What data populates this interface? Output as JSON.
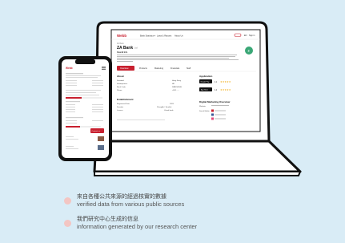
{
  "colors": {
    "background": "#d9ecf6",
    "brand_red": "#c8202f",
    "accent_green": "#3aa776",
    "legend_dot": "#f3c6c3",
    "outline": "#111111"
  },
  "laptop_screen": {
    "brand": "Webb",
    "nav": [
      "Bank Statistics ▾",
      "Laws & Reports",
      "About Us"
    ],
    "lang": "EN",
    "signin": "Sign in",
    "breadcrumb": "ZA Bank",
    "title": "ZA Bank",
    "title_badge": "Ltd",
    "subtitle": "Overall Info",
    "tabs": [
      "Overview",
      "Products",
      "Marketing",
      "Financials",
      "Staff"
    ],
    "about": {
      "heading": "About",
      "rows": [
        {
          "k": "Founded",
          "v": "Hong Kong"
        },
        {
          "k": "Headquarters",
          "v": "HK"
        },
        {
          "k": "Bank Code",
          "v": "ZABKHKHH"
        },
        {
          "k": "Phone",
          "v": "+852 ....."
        }
      ]
    },
    "establishment": {
      "heading": "Establishment",
      "rows": [
        {
          "k": "Registered Date",
          "v": "2019"
        },
        {
          "k": "Founder",
          "v": "ZhongAn / Sinolink"
        },
        {
          "k": "Licence",
          "v": "Virtual bank"
        }
      ]
    },
    "application": {
      "heading": "Application",
      "stores": [
        "Google Play",
        "App Store"
      ],
      "ratings": [
        "4.1",
        "4.4"
      ]
    },
    "digital": {
      "heading": "Digital Marketing Overview",
      "rows": [
        "Website",
        "Social Media"
      ]
    }
  },
  "phone_screen": {
    "brand": "Webb",
    "cta": "Contact us"
  },
  "legend": [
    {
      "zh": "來自各種公共來源的經過核實的數據",
      "en": "verified data from various public sources"
    },
    {
      "zh": "我們研究中心生成的信息",
      "en": "information generated by our research center"
    }
  ]
}
